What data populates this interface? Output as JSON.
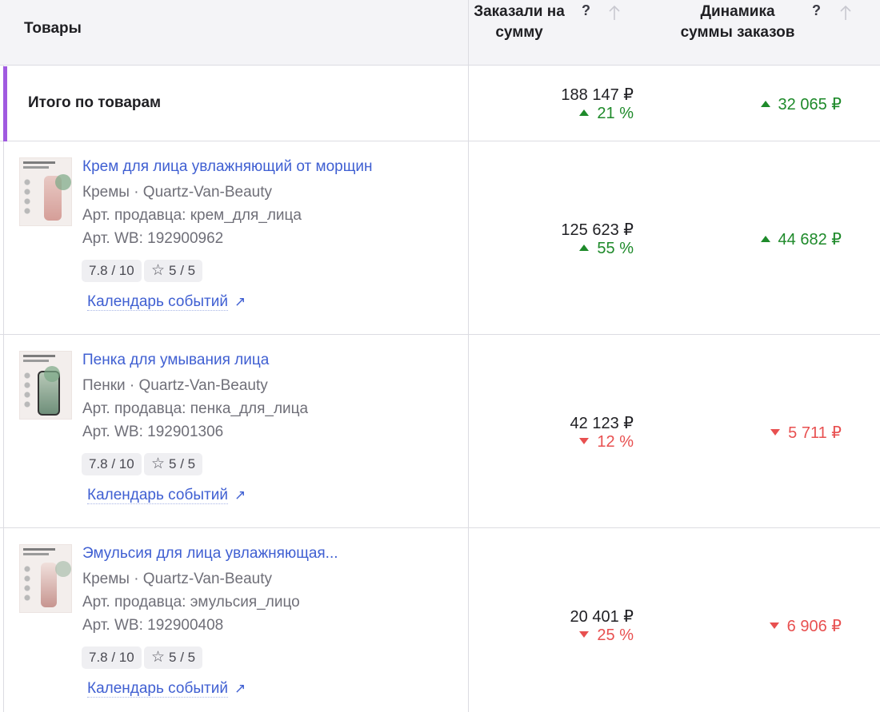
{
  "header": {
    "products_label": "Товары",
    "col_sum_line1": "Заказали на",
    "col_sum_line2": "сумму",
    "col_dyn_line1": "Динамика",
    "col_dyn_line2": "суммы заказов",
    "help_mark": "?"
  },
  "total": {
    "label": "Итого по товарам",
    "sum": "188 147 ₽",
    "pct": "21 %",
    "pct_trend": "up",
    "dynamic": "32 065 ₽",
    "dynamic_trend": "up"
  },
  "products": [
    {
      "title": "Крем для лица увлажняющий от морщин",
      "category": "Кремы · Quartz-Van-Beauty",
      "seller_article": "Арт. продавца: крем_для_лица",
      "wb_article": "Арт. WB: 192900962",
      "rating": "7.8 / 10",
      "stars": "5 / 5",
      "calendar_link": "Календарь событий",
      "sum": "125 623 ₽",
      "pct": "55 %",
      "pct_trend": "up",
      "dynamic": "44 682 ₽",
      "dynamic_trend": "up"
    },
    {
      "title": "Пенка для умывания лица",
      "category": "Пенки · Quartz-Van-Beauty",
      "seller_article": "Арт. продавца: пенка_для_лица",
      "wb_article": "Арт. WB: 192901306",
      "rating": "7.8 / 10",
      "stars": "5 / 5",
      "calendar_link": "Календарь событий",
      "sum": "42 123 ₽",
      "pct": "12 %",
      "pct_trend": "down",
      "dynamic": "5 711 ₽",
      "dynamic_trend": "down"
    },
    {
      "title": "Эмульсия для лица увлажняющая...",
      "category": "Кремы · Quartz-Van-Beauty",
      "seller_article": "Арт. продавца: эмульсия_лицо",
      "wb_article": "Арт. WB: 192900408",
      "rating": "7.8 / 10",
      "stars": "5 / 5",
      "calendar_link": "Календарь событий",
      "sum": "20 401 ₽",
      "pct": "25 %",
      "pct_trend": "down",
      "dynamic": "6 906 ₽",
      "dynamic_trend": "down"
    }
  ],
  "icons": {
    "sort": "arrow-up-icon",
    "help": "question-icon",
    "external": "arrow-up-right-icon",
    "star": "star-outline-icon"
  },
  "colors": {
    "accent": "#a05ae0",
    "link": "#3f5fd2",
    "up": "#1e8a2a",
    "down": "#e85050"
  }
}
